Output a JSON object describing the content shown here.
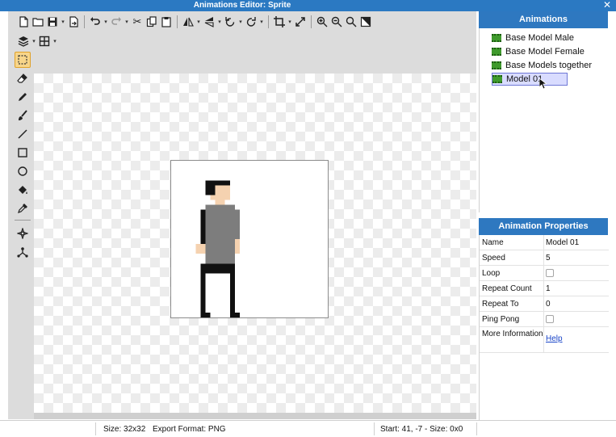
{
  "window": {
    "title": "Animations Editor: Sprite"
  },
  "toolbar": {
    "row1": [
      "new-file-icon",
      "open-folder-icon",
      "save-icon",
      "export-icon",
      "undo-icon",
      "redo-icon",
      "cut-icon",
      "copy-icon",
      "paste-icon",
      "flip-horizontal-icon",
      "flip-vertical-icon",
      "rotate-left-icon",
      "rotate-right-icon",
      "crop-icon",
      "resize-icon",
      "zoom-in-icon",
      "zoom-out-icon",
      "zoom-fit-icon",
      "zoom-actual-icon"
    ],
    "row2": [
      "layers-icon",
      "grid-icon"
    ]
  },
  "tools": [
    "select-tool-icon",
    "eraser-icon",
    "pencil-icon",
    "brush-icon",
    "line-icon",
    "rectangle-icon",
    "ellipse-icon",
    "fill-bucket-icon",
    "eyedropper-icon",
    "move-point-icon",
    "connect-nodes-icon"
  ],
  "animations_panel": {
    "title": "Animations",
    "items": [
      "Base Model Male",
      "Base Model Female",
      "Base Models together",
      "Model 01"
    ],
    "selected": "Model 01"
  },
  "properties_panel": {
    "title": "Animation Properties",
    "rows": [
      {
        "key": "Name",
        "value": "Model 01",
        "type": "text"
      },
      {
        "key": "Speed",
        "value": "5",
        "type": "text"
      },
      {
        "key": "Loop",
        "value": "",
        "type": "checkbox"
      },
      {
        "key": "Repeat Count",
        "value": "1",
        "type": "text"
      },
      {
        "key": "Repeat To",
        "value": "0",
        "type": "text"
      },
      {
        "key": "Ping Pong",
        "value": "",
        "type": "checkbox"
      },
      {
        "key": "More Information",
        "value": "Help",
        "type": "link"
      }
    ]
  },
  "status": {
    "size": "Size: 32x32",
    "export_format": "Export Format: PNG",
    "cursor_info": "Start: 41, -7 - Size: 0x0"
  },
  "colors": {
    "titlebar": "#2b79c2",
    "panel_header": "#2e78c0",
    "selection": "#d9dcff",
    "active_tool": "#f7d58a"
  }
}
